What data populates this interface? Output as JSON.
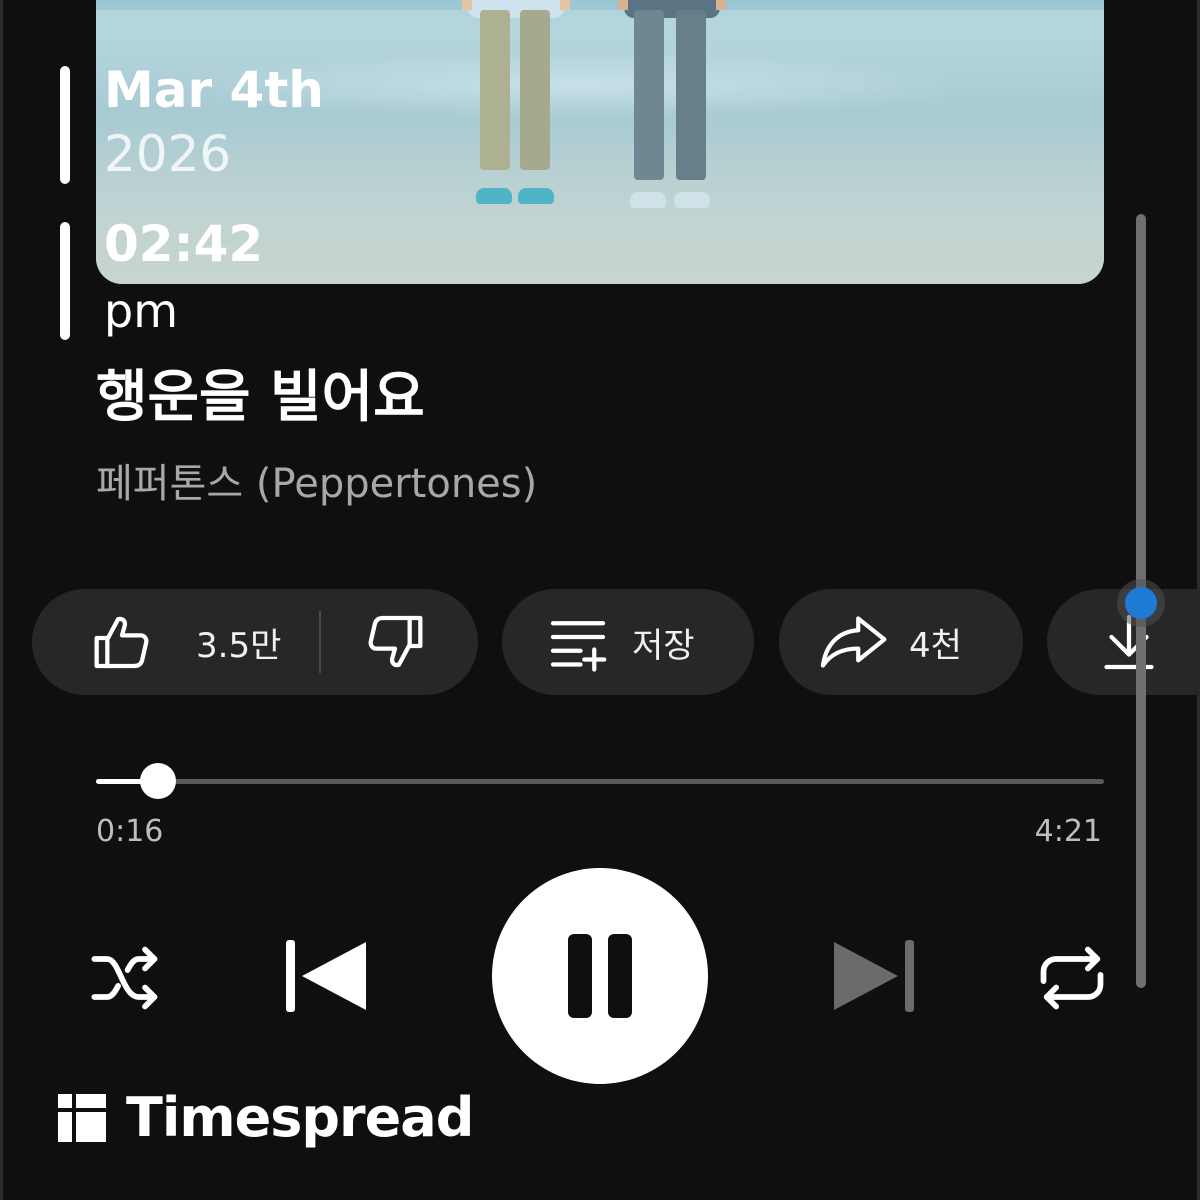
{
  "overlay": {
    "date_month_day": "Mar 4th",
    "date_year": "2026",
    "time": "02:42",
    "ampm": "pm"
  },
  "song": {
    "title": "행운을 빌어요",
    "artist": "페퍼톤스 (Peppertones)"
  },
  "actions": {
    "like_count": "3.5만",
    "save_label": "저장",
    "share_count": "4천"
  },
  "player": {
    "current_time": "0:16",
    "total_time": "4:21",
    "progress_fraction": 0.0613,
    "is_playing": true
  },
  "brand": {
    "name": "Timespread"
  },
  "colors": {
    "background": "#0f0f0f",
    "chip": "#272727",
    "accent_scroll": "#1e7bd4",
    "secondary_text": "#a8a8a8"
  },
  "icons": [
    "like-icon",
    "dislike-icon",
    "save-playlist-icon",
    "share-icon",
    "download-icon",
    "shuffle-icon",
    "previous-icon",
    "pause-icon",
    "next-icon",
    "repeat-icon",
    "timespread-logo-icon"
  ]
}
